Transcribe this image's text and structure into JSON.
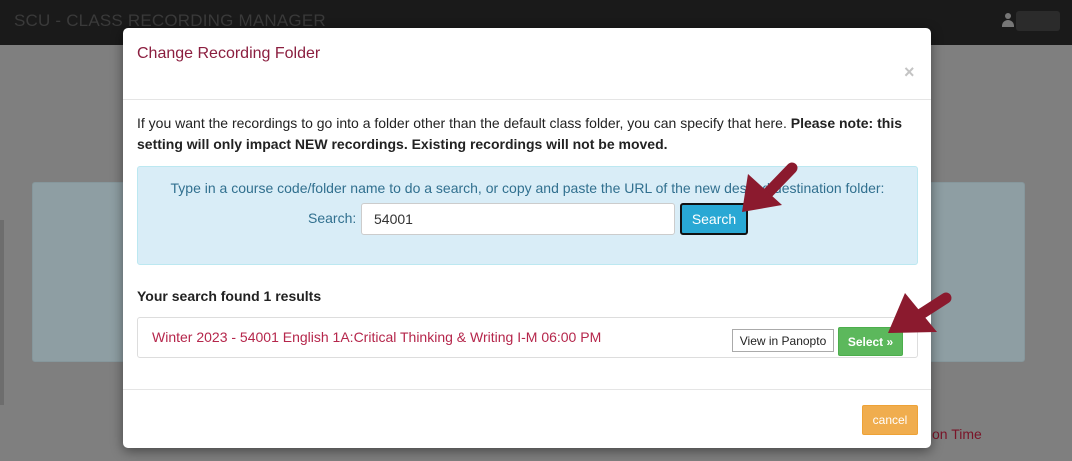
{
  "background": {
    "app_title": "SCU - CLASS RECORDING MANAGER",
    "partial_link": "on Time"
  },
  "modal": {
    "title": "Change Recording Folder",
    "close_label": "×",
    "intro_text": "If you want the recordings to go into a folder other than the default class folder, you can specify that here. ",
    "intro_bold": "Please note: this setting will only impact NEW recordings. Existing recordings will not be moved.",
    "search": {
      "instructions": "Type in a course code/folder name to do a search, or copy and paste the URL of the new desired destination folder:",
      "label": "Search:",
      "value": "54001",
      "button_label": "Search"
    },
    "results": {
      "heading": "Your search found 1 results",
      "items": [
        {
          "title": "Winter 2023 - 54001 English 1A:Critical Thinking & Writing I-M 06:00 PM",
          "view_label": "View in Panopto",
          "select_label": "Select »"
        }
      ]
    },
    "cancel_label": "cancel"
  },
  "colors": {
    "title": "#8b1e3f",
    "result_link": "#b5264b",
    "search_button": "#29a8d4",
    "select_button": "#5cb85c",
    "cancel_button": "#f0ad4e",
    "annotation_arrow": "#8b1a2e"
  },
  "icons": [
    "user-icon",
    "close-icon",
    "annotation-arrow-icon"
  ]
}
